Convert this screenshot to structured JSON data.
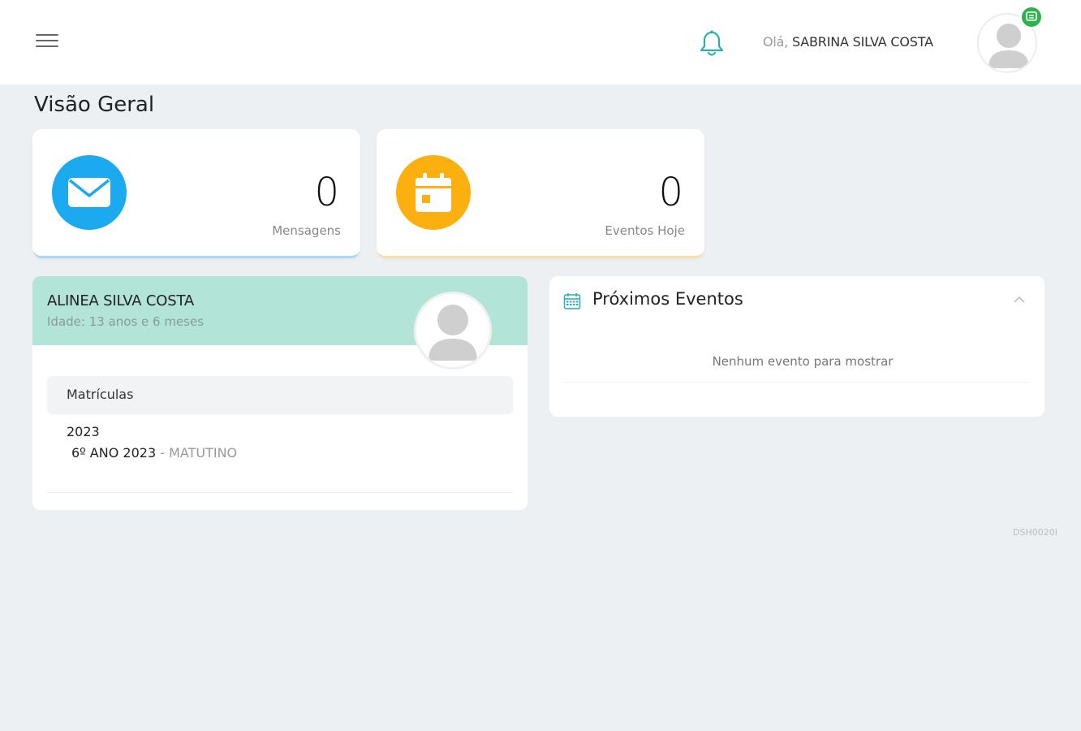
{
  "header": {
    "greeting_prefix": "Olá,",
    "user_name": "SABRINA SILVA COSTA",
    "icons": {
      "menu": "hamburger-menu-icon",
      "notifications": "bell-icon",
      "avatar": "user-avatar-icon",
      "status": "chat-status-icon"
    }
  },
  "page": {
    "title": "Visão Geral"
  },
  "stats": {
    "messages": {
      "value": "0",
      "label": "Mensagens",
      "icon": "envelope-icon",
      "color": "#1ba9f0"
    },
    "events_today": {
      "value": "0",
      "label": "Eventos Hoje",
      "icon": "calendar-icon",
      "color": "#fbb010"
    }
  },
  "student": {
    "name": "ALINEA SILVA COSTA",
    "age": "Idade: 13 anos e 6 meses",
    "enrollments_header": "Matrículas",
    "enrollments": [
      {
        "year": "2023",
        "class": "6º ANO 2023",
        "separator": "-",
        "shift": "MATUTINO"
      }
    ]
  },
  "upcoming_events": {
    "title": "Próximos Eventos",
    "empty_message": "Nenhum evento para mostrar"
  },
  "footer": {
    "code": "DSH0020I"
  },
  "colors": {
    "background": "#edf0f3",
    "student_header": "#b2e4d7",
    "accent_teal": "#27aeb6",
    "status_green": "#2fb24c"
  }
}
